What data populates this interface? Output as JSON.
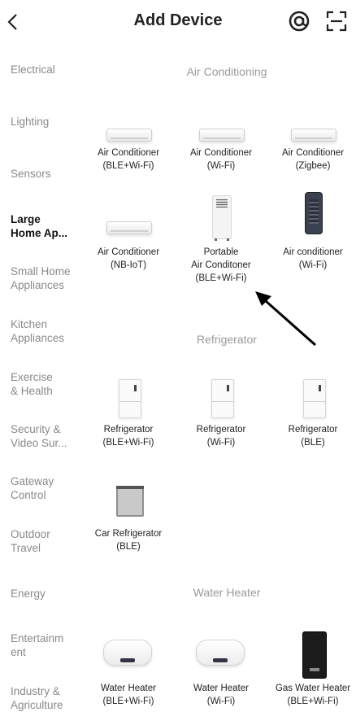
{
  "header": {
    "title": "Add Device",
    "back_icon": "chevron-left-icon",
    "at_icon": "at-sign-icon",
    "scan_icon": "scan-frame-icon"
  },
  "sidebar": {
    "items": [
      {
        "label": "Electrical"
      },
      {
        "label": "Lighting"
      },
      {
        "label": "Sensors"
      },
      {
        "label": "Large\nHome Ap...",
        "active": true
      },
      {
        "label": "Small Home\nAppliances"
      },
      {
        "label": "Kitchen\nAppliances"
      },
      {
        "label": "Exercise\n& Health"
      },
      {
        "label": "Security &\nVideo Sur..."
      },
      {
        "label": "Gateway\nControl"
      },
      {
        "label": "Outdoor\nTravel"
      },
      {
        "label": "Energy"
      },
      {
        "label": "Entertainm\nent"
      },
      {
        "label": "Industry &\nAgriculture"
      }
    ]
  },
  "sections": {
    "air_conditioning": {
      "title": "Air Conditioning",
      "items": [
        {
          "label": "Air Conditioner\n(BLE+Wi-Fi)",
          "icon": "air-conditioner-icon"
        },
        {
          "label": "Air Conditioner\n(Wi-Fi)",
          "icon": "air-conditioner-icon"
        },
        {
          "label": "Air Conditioner\n(Zigbee)",
          "icon": "air-conditioner-icon"
        },
        {
          "label": "Air Conditioner\n(NB-IoT)",
          "icon": "air-conditioner-icon"
        },
        {
          "label": "Portable\nAir Conditoner\n(BLE+Wi-Fi)",
          "icon": "portable-ac-icon"
        },
        {
          "label": "Air conditioner\n(Wi-Fi)",
          "icon": "tower-ac-icon"
        }
      ]
    },
    "refrigerator": {
      "title": "Refrigerator",
      "items": [
        {
          "label": "Refrigerator\n(BLE+Wi-Fi)",
          "icon": "refrigerator-icon"
        },
        {
          "label": "Refrigerator\n(Wi-Fi)",
          "icon": "refrigerator-icon"
        },
        {
          "label": "Refrigerator\n(BLE)",
          "icon": "refrigerator-icon"
        },
        {
          "label": "Car Refrigerator\n(BLE)",
          "icon": "car-refrigerator-icon"
        }
      ]
    },
    "water_heater": {
      "title": "Water Heater",
      "items": [
        {
          "label": "Water Heater\n(BLE+Wi-Fi)",
          "icon": "water-heater-icon"
        },
        {
          "label": "Water Heater\n(Wi-Fi)",
          "icon": "water-heater-icon"
        },
        {
          "label": "Gas Water Heater\n(BLE+Wi-Fi)",
          "icon": "gas-water-heater-icon"
        }
      ]
    }
  },
  "annotation": {
    "icon": "pointer-arrow-icon"
  }
}
